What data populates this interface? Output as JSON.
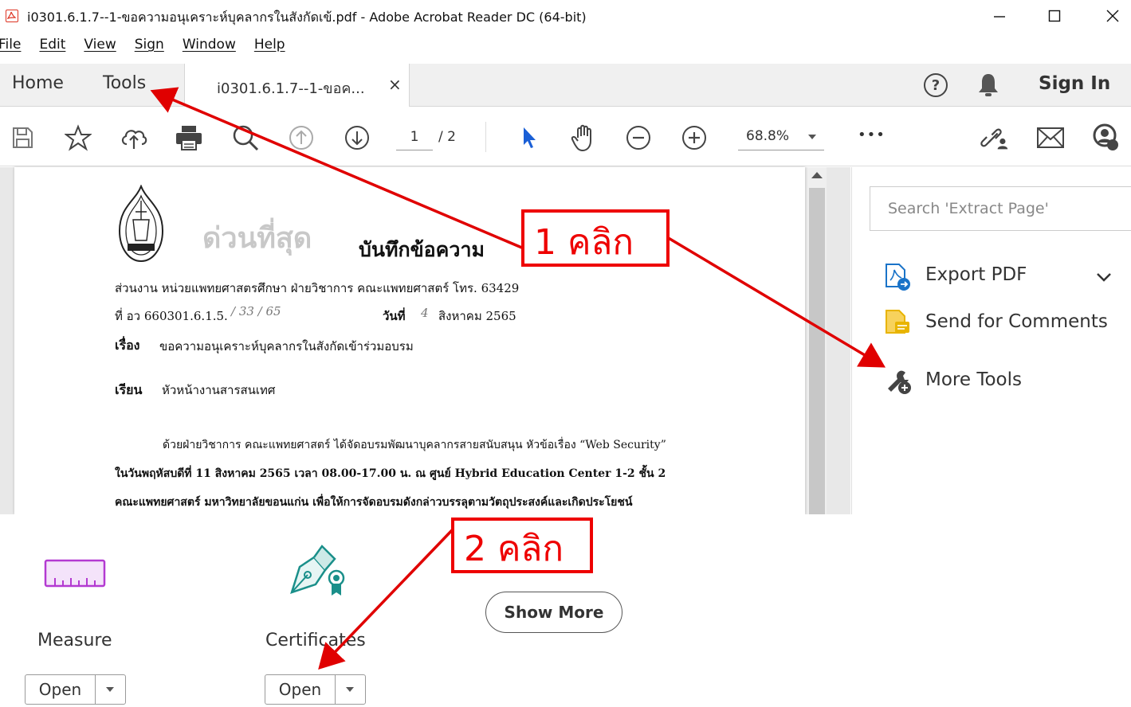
{
  "window": {
    "title": "i0301.6.1.7--1-ขอความอนุเคราะห์บุคลากรในสังกัดเข้.pdf - Adobe Acrobat Reader DC (64-bit)",
    "controls": [
      "minimize",
      "maximize",
      "close"
    ]
  },
  "menu": [
    "File",
    "Edit",
    "View",
    "Sign",
    "Window",
    "Help"
  ],
  "tabs": {
    "home": "Home",
    "tools": "Tools",
    "document": "i0301.6.1.7--1-ขอค...",
    "close": "×"
  },
  "header_right": {
    "sign_in": "Sign In"
  },
  "toolbar": {
    "page_current": "1",
    "page_total": "/ 2",
    "zoom": "68.8%",
    "more": "•••"
  },
  "document": {
    "urgency_stamp": "ด่วนที่สุด",
    "heading": "บันทึกข้อความ",
    "department": "ส่วนงาน  หน่วยแพทยศาสตรศึกษา  ฝ่ายวิชาการ  คณะแพทยศาสตร์  โทร. 63429",
    "ref_no": "ที่ อว 660301.6.1.5.",
    "ref_hand": "/ 33   / 65",
    "date_label": "วันที่",
    "date_hand": "4",
    "date_value": "สิงหาคม 2565",
    "subject_label": "เรื่อง",
    "subject": "ขอความอนุเคราะห์บุคลากรในสังกัดเข้าร่วมอบรม",
    "to_label": "เรียน",
    "to": "หัวหน้างานสารสนเทศ",
    "body_1": "ด้วยฝ่ายวิชาการ คณะแพทยศาสตร์ ได้จัดอบรมพัฒนาบุคลากรสายสนับสนุน หัวข้อเรื่อง “Web Security”",
    "body_2": "ในวันพฤหัสบดีที่ 11 สิงหาคม 2565 เวลา 08.00-17.00 น.  ณ ศูนย์ Hybrid Education Center 1-2 ชั้น 2",
    "body_3": "คณะแพทยศาสตร์ มหาวิทยาลัยขอนแก่น   เพื่อให้การจัดอบรมดังกล่าวบรรลุตามวัตถุประสงค์และเกิดประโยชน์"
  },
  "right_pane": {
    "search_placeholder": "Search 'Extract Page'",
    "items": [
      {
        "label": "Export PDF",
        "icon": "export-pdf-icon"
      },
      {
        "label": "Send for Comments",
        "icon": "send-comments-icon"
      },
      {
        "label": "More Tools",
        "icon": "more-tools-icon"
      }
    ]
  },
  "tools_panel": {
    "tools": [
      {
        "name": "Measure",
        "open": "Open",
        "icon": "ruler-icon"
      },
      {
        "name": "Certificates",
        "open": "Open",
        "icon": "certificate-pen-icon"
      }
    ],
    "show_more": "Show More"
  },
  "annotations": {
    "step1": "1 คลิก",
    "step2": "2 คลิก",
    "color": "#e00000"
  },
  "colors": {
    "tab_bar": "#f0f0f0",
    "selection_arrow": "#1a5fd6",
    "measure_icon": "#b33ad1",
    "certificate_icon": "#1a8f8a",
    "send_comments_icon": "#e8b400"
  }
}
